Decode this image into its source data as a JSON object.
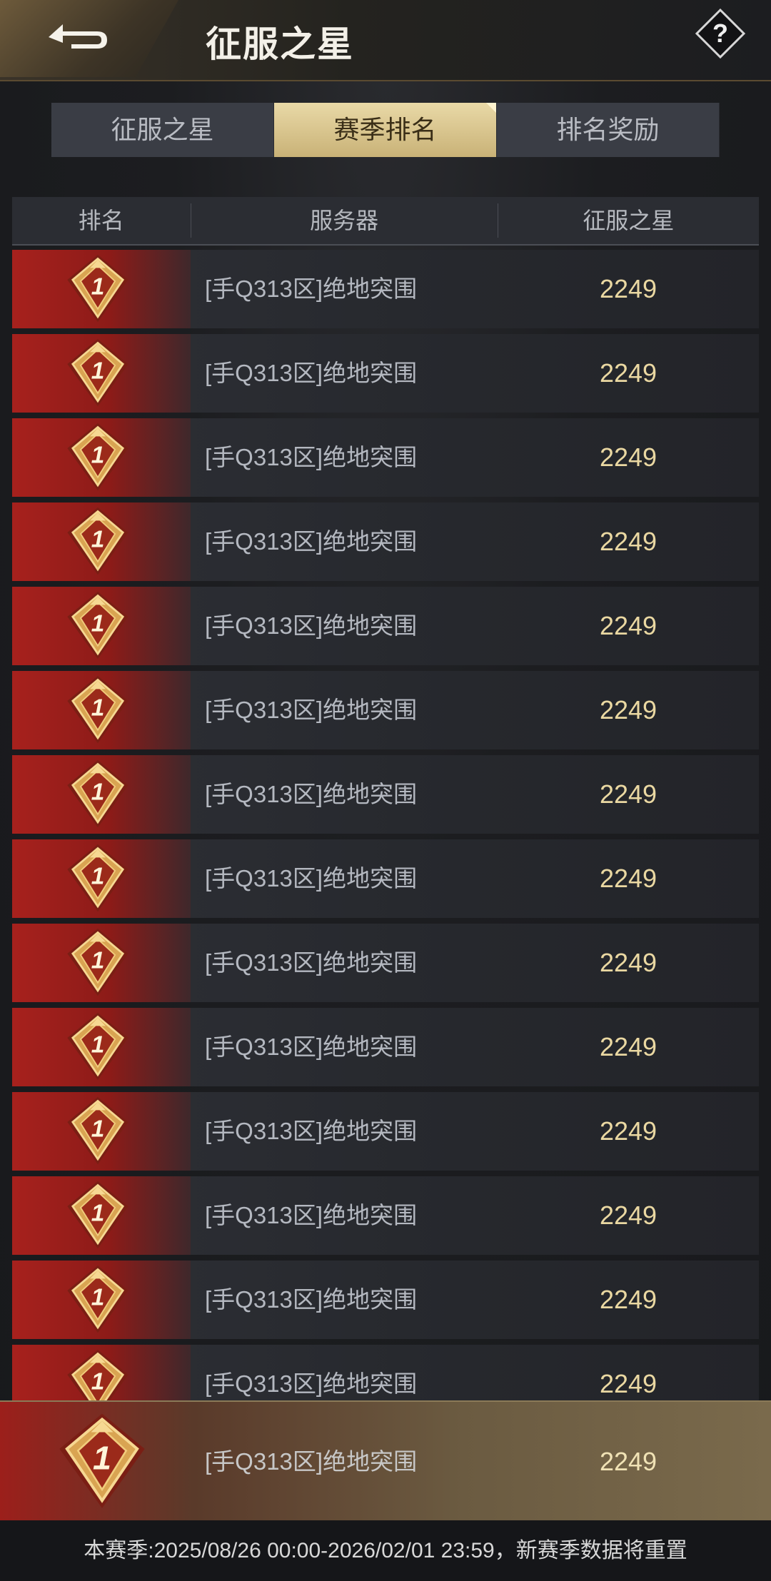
{
  "header": {
    "title": "征服之星"
  },
  "tabs": [
    {
      "label": "征服之星",
      "active": false
    },
    {
      "label": "赛季排名",
      "active": true
    },
    {
      "label": "排名奖励",
      "active": false
    }
  ],
  "table": {
    "columns": [
      "排名",
      "服务器",
      "征服之星"
    ],
    "rows": [
      {
        "rank": "1",
        "server": "[手Q313区]绝地突围",
        "score": "2249"
      },
      {
        "rank": "1",
        "server": "[手Q313区]绝地突围",
        "score": "2249"
      },
      {
        "rank": "1",
        "server": "[手Q313区]绝地突围",
        "score": "2249"
      },
      {
        "rank": "1",
        "server": "[手Q313区]绝地突围",
        "score": "2249"
      },
      {
        "rank": "1",
        "server": "[手Q313区]绝地突围",
        "score": "2249"
      },
      {
        "rank": "1",
        "server": "[手Q313区]绝地突围",
        "score": "2249"
      },
      {
        "rank": "1",
        "server": "[手Q313区]绝地突围",
        "score": "2249"
      },
      {
        "rank": "1",
        "server": "[手Q313区]绝地突围",
        "score": "2249"
      },
      {
        "rank": "1",
        "server": "[手Q313区]绝地突围",
        "score": "2249"
      },
      {
        "rank": "1",
        "server": "[手Q313区]绝地突围",
        "score": "2249"
      },
      {
        "rank": "1",
        "server": "[手Q313区]绝地突围",
        "score": "2249"
      },
      {
        "rank": "1",
        "server": "[手Q313区]绝地突围",
        "score": "2249"
      },
      {
        "rank": "1",
        "server": "[手Q313区]绝地突围",
        "score": "2249"
      },
      {
        "rank": "1",
        "server": "[手Q313区]绝地突围",
        "score": "2249"
      }
    ]
  },
  "my_row": {
    "rank": "1",
    "server": "[手Q313区]绝地突围",
    "score": "2249"
  },
  "footer": {
    "text": "本赛季:2025/08/26 00:00-2026/02/01 23:59，新赛季数据将重置"
  },
  "icons": {
    "back": "back-arrow-icon",
    "help": "question-mark-icon",
    "rank": "rank-one-badge-icon"
  },
  "colors": {
    "accent_gold": "#e9d9a7",
    "score_gold": "#ead8a2",
    "rank_red": "#a7211d"
  }
}
